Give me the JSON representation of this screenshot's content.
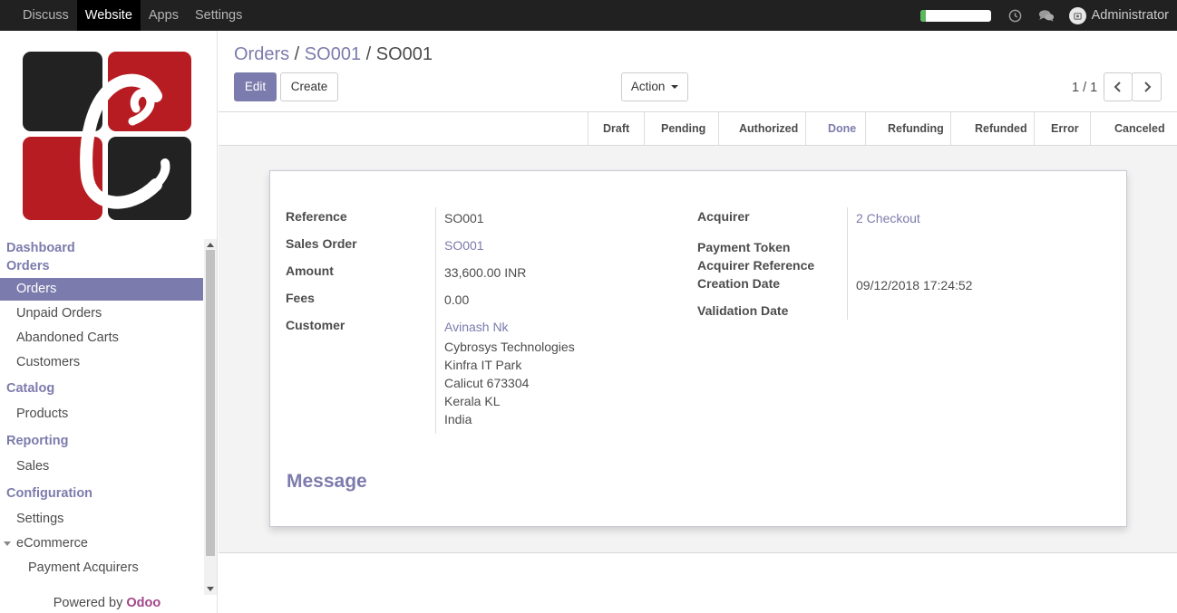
{
  "topbar": {
    "menu": [
      "Discuss",
      "Website",
      "Apps",
      "Settings"
    ],
    "active": "Website",
    "progress": 0.08,
    "user": "Administrator",
    "icons": [
      "clock-icon",
      "chat-icon"
    ]
  },
  "sidebar": {
    "sections": {
      "dashboard": "Dashboard",
      "orders": "Orders",
      "catalog": "Catalog",
      "reporting": "Reporting",
      "configuration": "Configuration"
    },
    "items": {
      "orders": "Orders",
      "unpaid_orders": "Unpaid Orders",
      "abandoned_carts": "Abandoned Carts",
      "customers": "Customers",
      "products": "Products",
      "sales": "Sales",
      "settings": "Settings",
      "ecommerce": "eCommerce",
      "payment_acquirers": "Payment Acquirers"
    },
    "powered_by": "Powered by",
    "brand": "Odoo"
  },
  "breadcrumb": {
    "first": "Orders",
    "second": "SO001",
    "current": "SO001"
  },
  "buttons": {
    "edit": "Edit",
    "create": "Create",
    "action": "Action"
  },
  "pager": {
    "text": "1 / 1"
  },
  "statusbar": {
    "steps": [
      "Draft",
      "Pending",
      "Authorized",
      "Done",
      "Refunding",
      "Refunded",
      "Error",
      "Canceled"
    ],
    "current": "Done"
  },
  "form": {
    "labels": {
      "reference": "Reference",
      "sales_order": "Sales Order",
      "amount": "Amount",
      "fees": "Fees",
      "customer": "Customer",
      "acquirer": "Acquirer",
      "payment_token": "Payment Token",
      "acquirer_reference": "Acquirer Reference",
      "creation_date": "Creation Date",
      "validation_date": "Validation Date"
    },
    "values": {
      "reference": "SO001",
      "sales_order": "SO001",
      "amount": "33,600.00",
      "currency": "INR",
      "fees": "0.00",
      "customer_name": "Avinash Nk",
      "customer_address": [
        "Cybrosys Technologies",
        "Kinfra IT Park",
        "Calicut 673304",
        "Kerala KL",
        "India"
      ],
      "acquirer": "2 Checkout",
      "creation_date": "09/12/2018 17:24:52"
    },
    "message_title": "Message"
  }
}
